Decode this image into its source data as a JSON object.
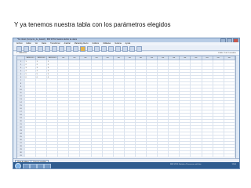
{
  "caption": "Y ya tenemos nuestra tabla con los parámetros elegidos",
  "window": {
    "title": "*Sin título1 [Conjunto_de_datos0] - IBM SPSS Statistics Editor de datos"
  },
  "menu": [
    "Archivo",
    "Editar",
    "Ver",
    "Datos",
    "Transformar",
    "Analizar",
    "Marketing directo",
    "Gráficos",
    "Utilidades",
    "Ventana",
    "Ayuda"
  ],
  "varinfo": {
    "label": "1 : VAR00001",
    "visible": "Visible: 3 de 3 variables"
  },
  "grid": {
    "columns": [
      "VAR00001",
      "VAR00002",
      "VAR00003",
      "var",
      "var",
      "var",
      "var",
      "var",
      "var",
      "var",
      "var",
      "var",
      "var",
      "var",
      "var",
      "var",
      "var",
      "var",
      "var"
    ],
    "data_rows": [
      [
        "1",
        "1",
        "1"
      ],
      [
        "2",
        "2",
        "2"
      ],
      [
        "3",
        "3",
        "3"
      ],
      [
        "4",
        "4",
        "4"
      ],
      [
        "5",
        "5",
        "5"
      ],
      [
        "6",
        "6",
        "6"
      ]
    ],
    "row_count": 31
  },
  "tabs": {
    "data_view": "Vista de datos",
    "variable_view": "Vista de variables"
  },
  "status": "IBM SPSS Statistics Processor está listo",
  "clock": "12:00"
}
